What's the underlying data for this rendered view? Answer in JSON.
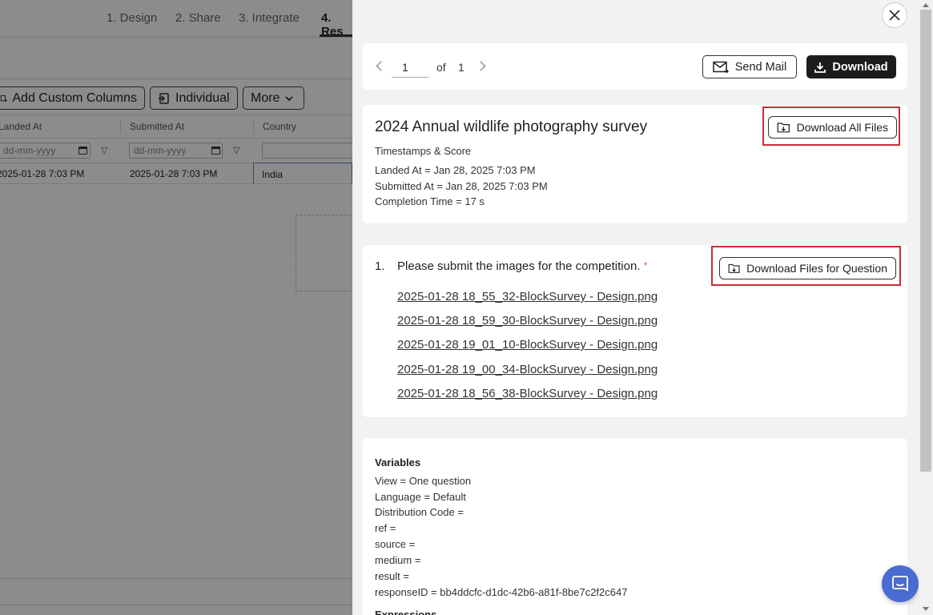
{
  "background": {
    "tabs": [
      "1. Design",
      "2. Share",
      "3. Integrate",
      "4. Res"
    ],
    "toolbar": {
      "add_columns": "Add Custom Columns",
      "individual": "Individual",
      "more": "More"
    },
    "columns": [
      "Landed At",
      "Submitted At",
      "Country"
    ],
    "date_placeholder": "dd-mm-yyyy",
    "row": {
      "landed_at": "2025-01-28 7:03 PM",
      "submitted_at": "2025-01-28 7:03 PM",
      "country": "India"
    }
  },
  "drawer": {
    "nav": {
      "page": "1",
      "of_label": "of",
      "total": "1",
      "send_mail": "Send Mail",
      "download": "Download"
    },
    "info": {
      "title": "2024 Annual wildlife photography survey",
      "subheading": "Timestamps & Score",
      "landed": "Landed At = Jan 28, 2025 7:03 PM",
      "submitted": "Submitted At = Jan 28, 2025 7:03 PM",
      "completion": "Completion Time = 17 s",
      "download_all": "Download All Files"
    },
    "question": {
      "number": "1.",
      "text": "Please submit the images for the competition.",
      "required_mark": "*",
      "download_question": "Download Files for Question",
      "files": [
        "2025-01-28 18_55_32-BlockSurvey - Design.png",
        "2025-01-28 18_59_30-BlockSurvey - Design.png",
        "2025-01-28 19_01_10-BlockSurvey - Design.png",
        "2025-01-28 19_00_34-BlockSurvey - Design.png",
        "2025-01-28 18_56_38-BlockSurvey - Design.png"
      ]
    },
    "variables": {
      "title": "Variables",
      "lines": [
        "View = One question",
        "Language = Default",
        "Distribution Code =",
        "ref =",
        "source =",
        "medium =",
        "result =",
        "responseID = bb4ddcfc-d1dc-42b6-a81f-8be7c2f2c647"
      ],
      "expressions_title": "Expressions"
    }
  },
  "icons": {
    "close": "close-icon",
    "mail": "mail-icon",
    "download": "download-icon",
    "folder_download": "folder-download-icon",
    "chat": "chat-icon"
  },
  "colors": {
    "highlight_box": "#cc2b36",
    "primary_button": "#1c1c1c",
    "chat_button": "#4a6bd1",
    "required": "#e06060"
  }
}
